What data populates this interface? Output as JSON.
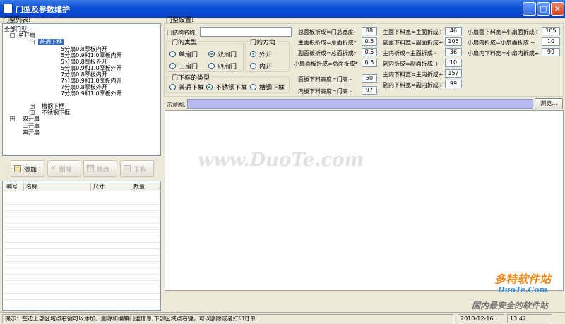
{
  "window": {
    "title": "门型及参数维护"
  },
  "left": {
    "label": "门型列表:",
    "tree": {
      "root": "全部门型",
      "single": "单开扇",
      "normal_frame": "普通下框",
      "items": [
        "5分扇0.8厚板内开",
        "5分扇0.9和1.0厚板内开",
        "5分扇0.8厚板外开",
        "5分扇0.9和1.0厚板外开",
        "7分扇0.8厚板内开",
        "7分扇0.9和1.0厚板内开",
        "7分扇0.8厚板外开",
        "7分扇0.9和1.0厚板外开"
      ],
      "channel_frame": "槽钢下框",
      "steel_frame": "不锈钢下框",
      "double": "双开扇",
      "triple": "三开扇",
      "quad": "四开扇"
    },
    "buttons": {
      "add": "添加",
      "delete": "删除",
      "edit": "修改",
      "cut": "下料"
    },
    "columns": [
      "编号",
      "名称",
      "尺寸",
      "数量"
    ]
  },
  "settings": {
    "label": "门型设置:",
    "name_label": "门结构名称:",
    "name_value": "",
    "door_type": {
      "title": "门的类型",
      "options": [
        "单扇门",
        "双扇门",
        "三扇门",
        "四扇门"
      ],
      "selected": "双扇门"
    },
    "direction": {
      "title": "门的方向",
      "options": [
        "外开",
        "内开"
      ],
      "selected": "外开"
    },
    "frame_type": {
      "title": "门下框的类型",
      "options": [
        "普通下框",
        "不锈钢下框",
        "槽钢下框"
      ],
      "selected": "不锈钢下框"
    },
    "col1": [
      {
        "label": "总面板折成=门总宽度-",
        "value": "88"
      },
      {
        "label": "主面板折成=总面折成*",
        "value": "0.5"
      },
      {
        "label": "副面板折成=总面折成*",
        "value": "0.5"
      },
      {
        "label": "小扇面板折成=总面折成*",
        "value": "0.5"
      },
      {
        "label": "面板下料高度=门高 -",
        "value": "50"
      },
      {
        "label": "内板下料高度=门高 -",
        "value": "97"
      }
    ],
    "col2": [
      {
        "label": "主面下料宽=主面折成+",
        "value": "46"
      },
      {
        "label": "副面下料宽=副面折成+",
        "value": "105"
      },
      {
        "label": "主内折成=主面折成 -",
        "value": "36"
      },
      {
        "label": "副内折成=副面折成 +",
        "value": "10"
      },
      {
        "label": "主内下料宽=主内折成+",
        "value": "157"
      },
      {
        "label": "副内下料宽=副内折成+",
        "value": "99"
      }
    ],
    "col3": [
      {
        "label": "小扇面下料宽=小扇面折成+",
        "value": "105"
      },
      {
        "label": "小扇内折成=小扇面折成 +",
        "value": "10"
      },
      {
        "label": "小扇内下料宽=小扇内折成+",
        "value": "99"
      }
    ],
    "preview_label": "示意图:",
    "browse": "浏览..."
  },
  "status": {
    "hint": "提示：左边上部区域点右键可以添加、删除和编辑门型信息;下部区域点右键，可以删除或者打印订单",
    "date": "2010-12-16",
    "time": "13:42"
  },
  "watermarks": {
    "center": "www.DuoTe.com",
    "brand": "多特软件站",
    "brand_url": "DuoTe.Com",
    "slogan": "国内最安全的软件站"
  }
}
